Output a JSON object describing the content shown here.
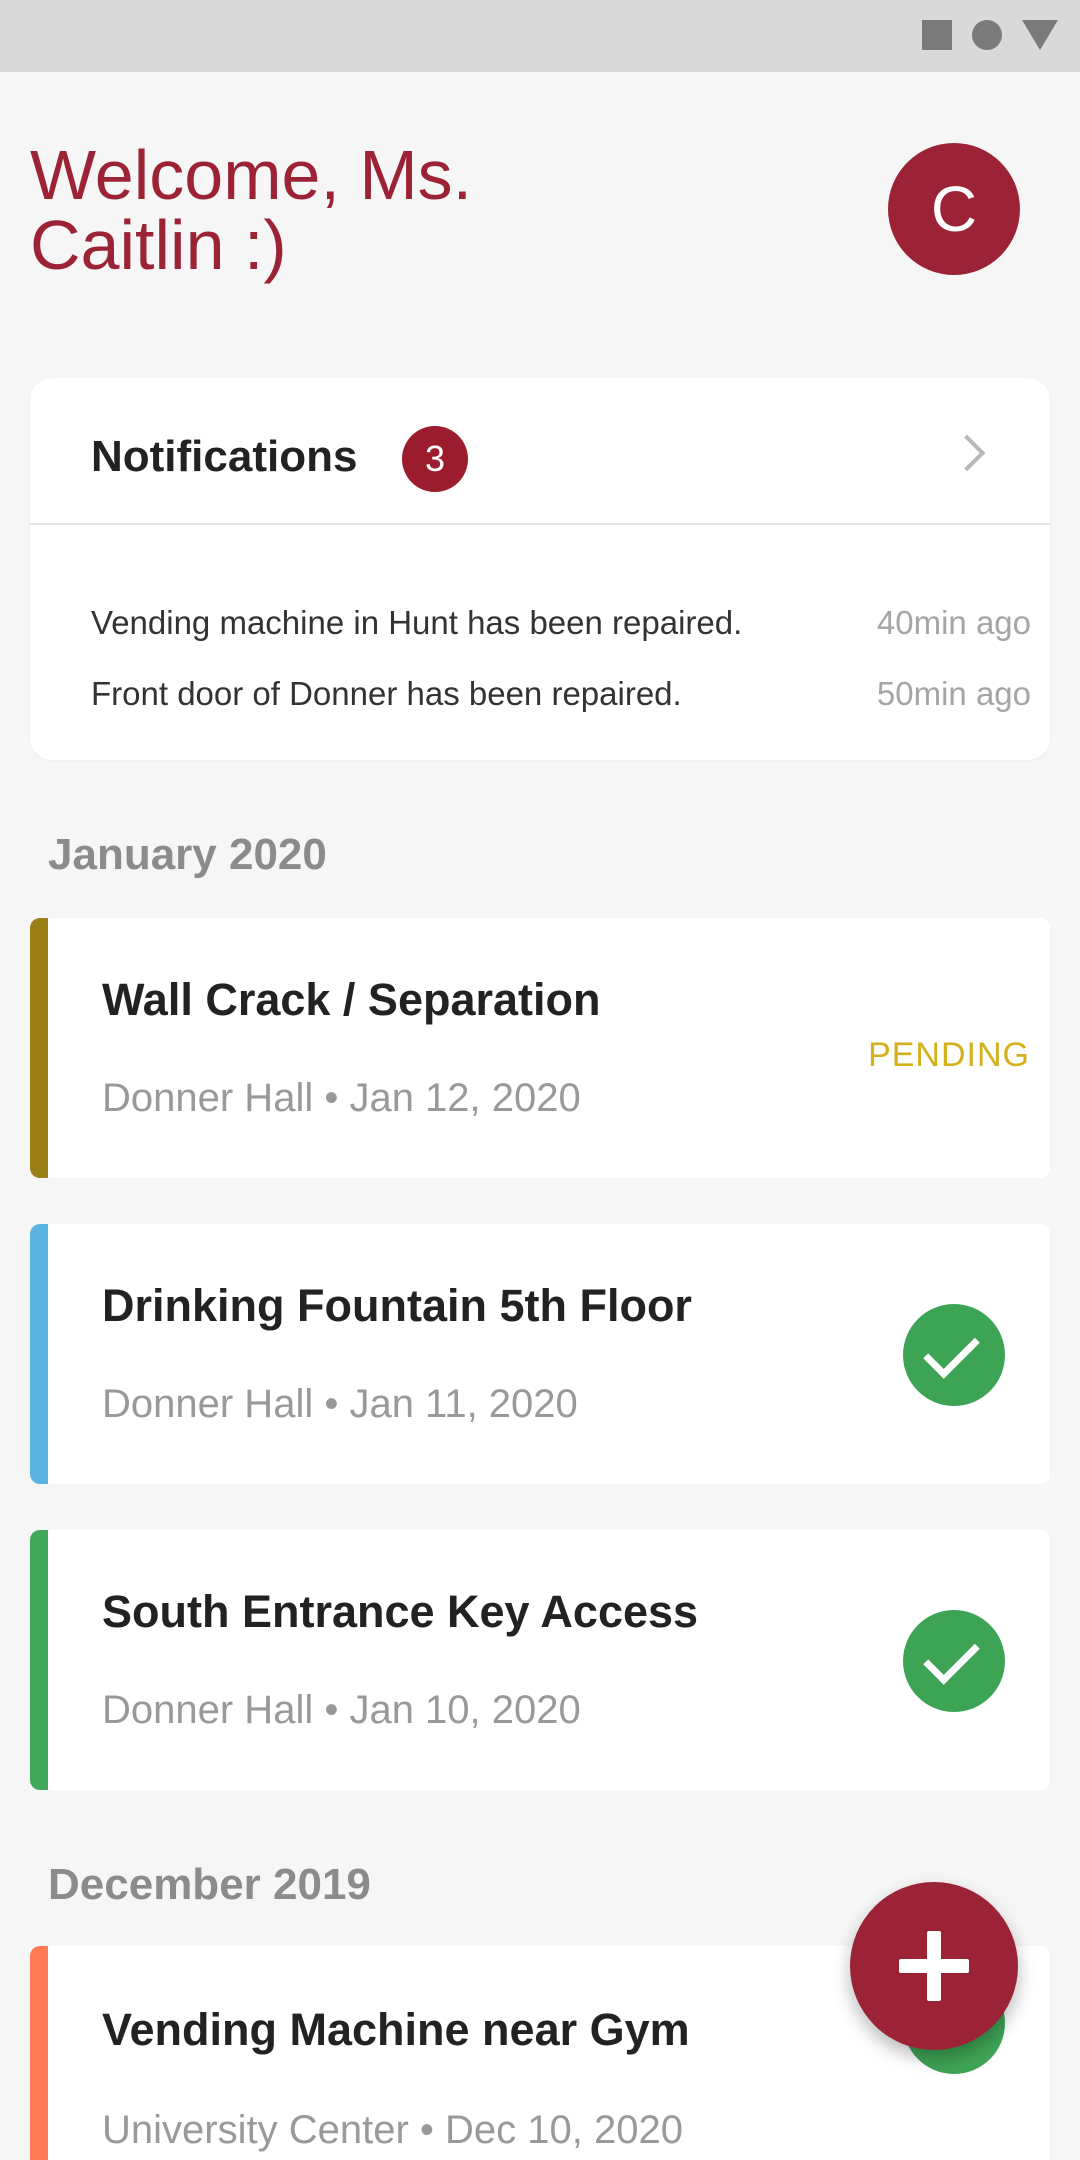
{
  "header": {
    "welcome": "Welcome, Ms. Caitlin :)",
    "avatar_letter": "C",
    "brand_color": "#9b2335"
  },
  "notifications": {
    "title": "Notifications",
    "count": "3",
    "items": [
      {
        "text": "Vending machine in Hunt has been repaired.",
        "time": "40min ago"
      },
      {
        "text": "Front door of Donner has been repaired.",
        "time": "50min ago"
      }
    ]
  },
  "sections": [
    {
      "title": "January 2020",
      "issues": [
        {
          "title": "Wall Crack / Separation",
          "meta": "Donner Hall • Jan 12, 2020",
          "status": "PENDING",
          "stripe_color": "#9c7f14"
        },
        {
          "title": "Drinking Fountain 5th Floor",
          "meta": "Donner Hall • Jan 11, 2020",
          "status": "completed",
          "stripe_color": "#5ab3e0"
        },
        {
          "title": "South Entrance Key Access",
          "meta": "Donner Hall • Jan 10, 2020",
          "status": "completed",
          "stripe_color": "#41a85a"
        }
      ]
    },
    {
      "title": "December 2019",
      "issues": [
        {
          "title": "Vending Machine near Gym",
          "meta": "University Center • Dec 10, 2020",
          "status": "completed",
          "stripe_color": "#ff7a55"
        }
      ]
    }
  ],
  "icons": {
    "status_square": "square-icon",
    "status_circle": "circle-icon",
    "status_triangle": "triangle-icon",
    "chevron": "chevron-right-icon",
    "check": "checkmark-icon",
    "fab": "plus-icon"
  }
}
